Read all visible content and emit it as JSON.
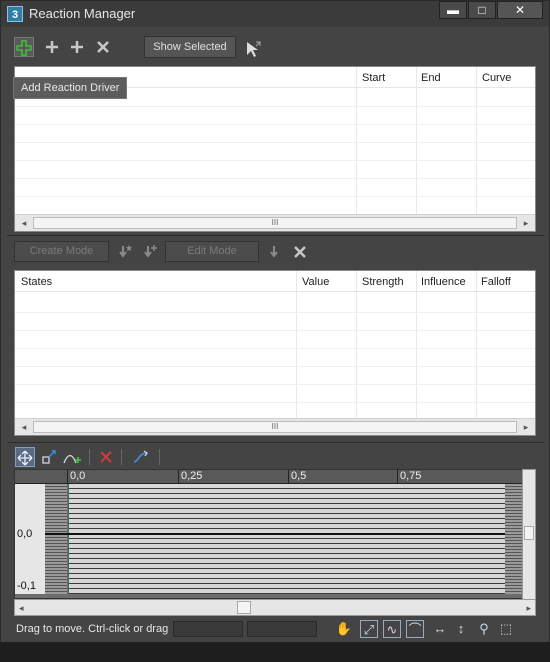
{
  "window": {
    "title": "Reaction Manager",
    "icon_text": "3"
  },
  "window_controls": {
    "minimize": "▬",
    "maximize": "□",
    "close": "✕"
  },
  "toolbar": {
    "show_selected_label": "Show Selected",
    "tooltip": "Add Reaction Driver"
  },
  "drivers_table": {
    "columns": [
      "Start",
      "End",
      "Curve"
    ]
  },
  "mode_bar": {
    "create_mode_label": "Create Mode",
    "edit_mode_label": "Edit Mode"
  },
  "states_table": {
    "columns": [
      "States",
      "Value",
      "Strength",
      "Influence",
      "Falloff"
    ]
  },
  "scrollbar": {
    "thumb_grip": "III"
  },
  "curve_editor": {
    "ruler_labels": [
      "0,0",
      "0,25",
      "0,5",
      "0,75"
    ],
    "y_labels": [
      "0,0",
      "-0,1"
    ],
    "view_position": 0.43
  },
  "status": {
    "message": "Drag to move. Ctrl-click or drag"
  },
  "colors": {
    "window_bg": "#444444",
    "accent_add": "#3fbf3f",
    "delete_red": "#d23a3a",
    "icon_blue": "#3d8bd9"
  }
}
